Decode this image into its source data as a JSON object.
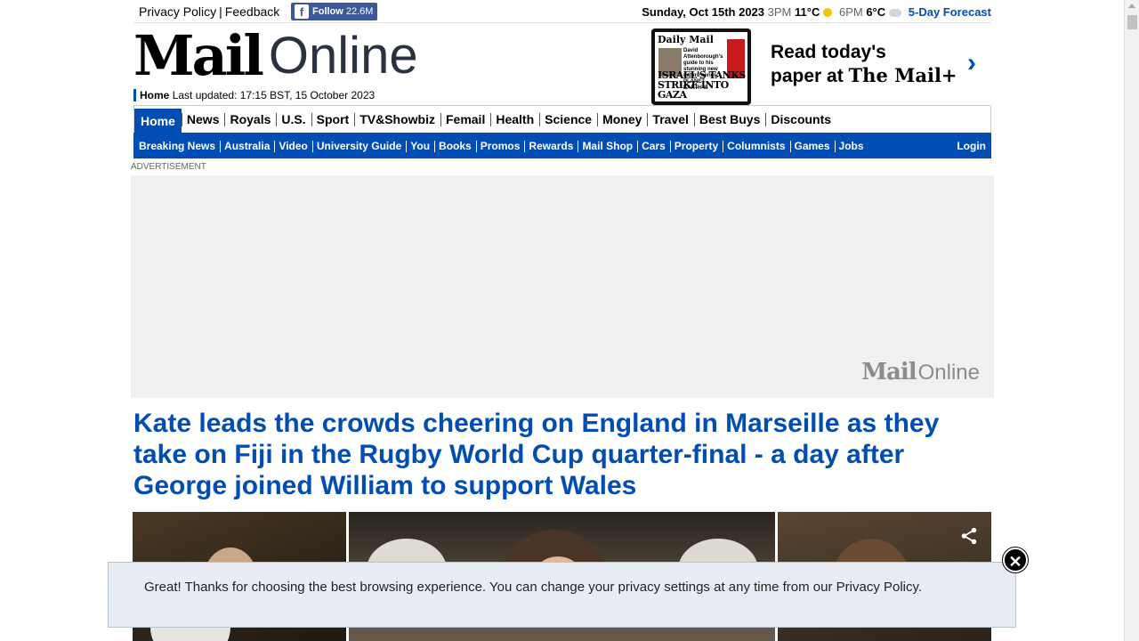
{
  "topbar": {
    "privacy_label": "Privacy Policy",
    "feedback_label": "Feedback",
    "facebook": {
      "label": "Follow",
      "count": "22.6M",
      "icon": "facebook-icon"
    },
    "date": "Sunday, Oct 15th 2023",
    "weather": [
      {
        "time": "3PM",
        "temp": "11°C",
        "icon": "sun-icon"
      },
      {
        "time": "6PM",
        "temp": "6°C",
        "icon": "partly-cloudy-icon"
      }
    ],
    "forecast_label": "5-Day Forecast"
  },
  "masthead": {
    "logo_mail": "Mail",
    "logo_online": "Online",
    "home_label": "Home",
    "last_updated": "Last updated: 17:15 BST, 15 October 2023"
  },
  "paper_promo": {
    "paper_title": "Daily Mail",
    "paper_story": "David Attenborough's guide to his stunning new nature series, PLANET EARTH III",
    "paper_headline": "ISRAEL'S TANKS STRIKE INTO GAZA",
    "line1": "Read today's",
    "line2": "paper at",
    "brand": "The Mail+",
    "chevron_icon": "chevron-right-icon"
  },
  "nav_primary": [
    "Home",
    "News",
    "Royals",
    "U.S.",
    "Sport",
    "TV&Showbiz",
    "Femail",
    "Health",
    "Science",
    "Money",
    "Travel",
    "Best Buys",
    "Discounts"
  ],
  "nav_secondary": [
    "Breaking News",
    "Australia",
    "Video",
    "University Guide",
    "You",
    "Books",
    "Promos",
    "Rewards",
    "Mail Shop",
    "Cars",
    "Property",
    "Columnists",
    "Games",
    "Jobs"
  ],
  "login_label": "Login",
  "advert": {
    "label": "ADVERTISEMENT",
    "logo_mail": "Mail",
    "logo_online": "Online"
  },
  "article": {
    "headline": "Kate leads the crowds cheering on England in Marseille as they take on Fiji in the Rugby World Cup quarter-final - a day after George joined William to support Wales",
    "share_icon": "share-icon"
  },
  "privacy_banner": {
    "text": "Great! Thanks for choosing the best browsing experience. You can change your privacy settings at any time from our Privacy Policy.",
    "close_icon": "close-icon"
  },
  "colors": {
    "brand_blue": "#004db3",
    "facebook_blue": "#3b5998"
  }
}
